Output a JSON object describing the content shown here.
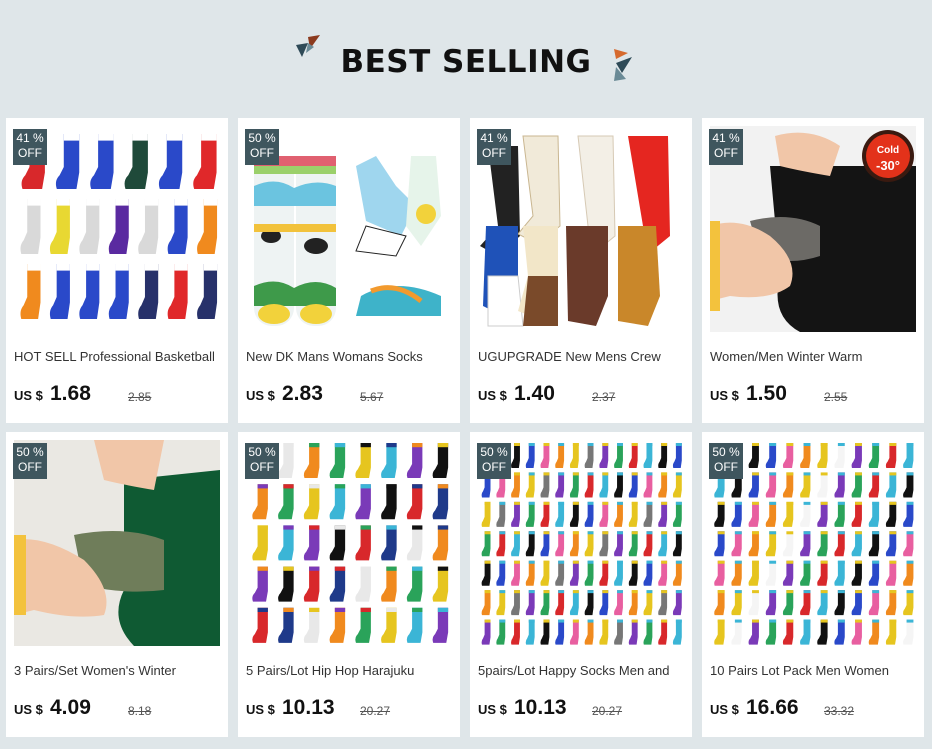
{
  "header": {
    "title": "BEST SELLING"
  },
  "products": [
    {
      "discount_pct": "41 %",
      "discount_label": "OFF",
      "title": "HOT SELL Professional Basketball",
      "currency": "US $",
      "price": "1.68",
      "old_price": "2.85",
      "image": "sports-socks"
    },
    {
      "discount_pct": "50 %",
      "discount_label": "OFF",
      "title": "New DK Mans Womans Socks",
      "currency": "US $",
      "price": "2.83",
      "old_price": "5.67",
      "image": "cow-print-socks"
    },
    {
      "discount_pct": "41 %",
      "discount_label": "OFF",
      "title": "UGUPGRADE New Mens Crew",
      "currency": "US $",
      "price": "1.40",
      "old_price": "2.37",
      "image": "crew-socks"
    },
    {
      "discount_pct": "41 %",
      "discount_label": "OFF",
      "title": "Women/Men Winter Warm",
      "currency": "US $",
      "price": "1.50",
      "old_price": "2.55",
      "image": "thermal-socks-black",
      "overlay_text": "Cold",
      "overlay_temp": "-30°"
    },
    {
      "discount_pct": "50 %",
      "discount_label": "OFF",
      "title": "3 Pairs/Set Women's Winter",
      "currency": "US $",
      "price": "4.09",
      "old_price": "8.18",
      "image": "thermal-socks-green"
    },
    {
      "discount_pct": "50 %",
      "discount_label": "OFF",
      "title": "5 Pairs/Lot Hip Hop Harajuku",
      "currency": "US $",
      "price": "10.13",
      "old_price": "20.27",
      "image": "pattern-socks-grid"
    },
    {
      "discount_pct": "50 %",
      "discount_label": "OFF",
      "title": "5pairs/Lot Happy Socks Men and",
      "currency": "US $",
      "price": "10.13",
      "old_price": "20.27",
      "image": "happy-socks-grid"
    },
    {
      "discount_pct": "50 %",
      "discount_label": "OFF",
      "title": "10 Pairs Lot Pack Men Women",
      "currency": "US $",
      "price": "16.66",
      "old_price": "33.32",
      "image": "pack-socks-grid"
    }
  ],
  "colors": {
    "background": "#dfe6e9",
    "badge": "#3f565e",
    "card": "#ffffff"
  }
}
